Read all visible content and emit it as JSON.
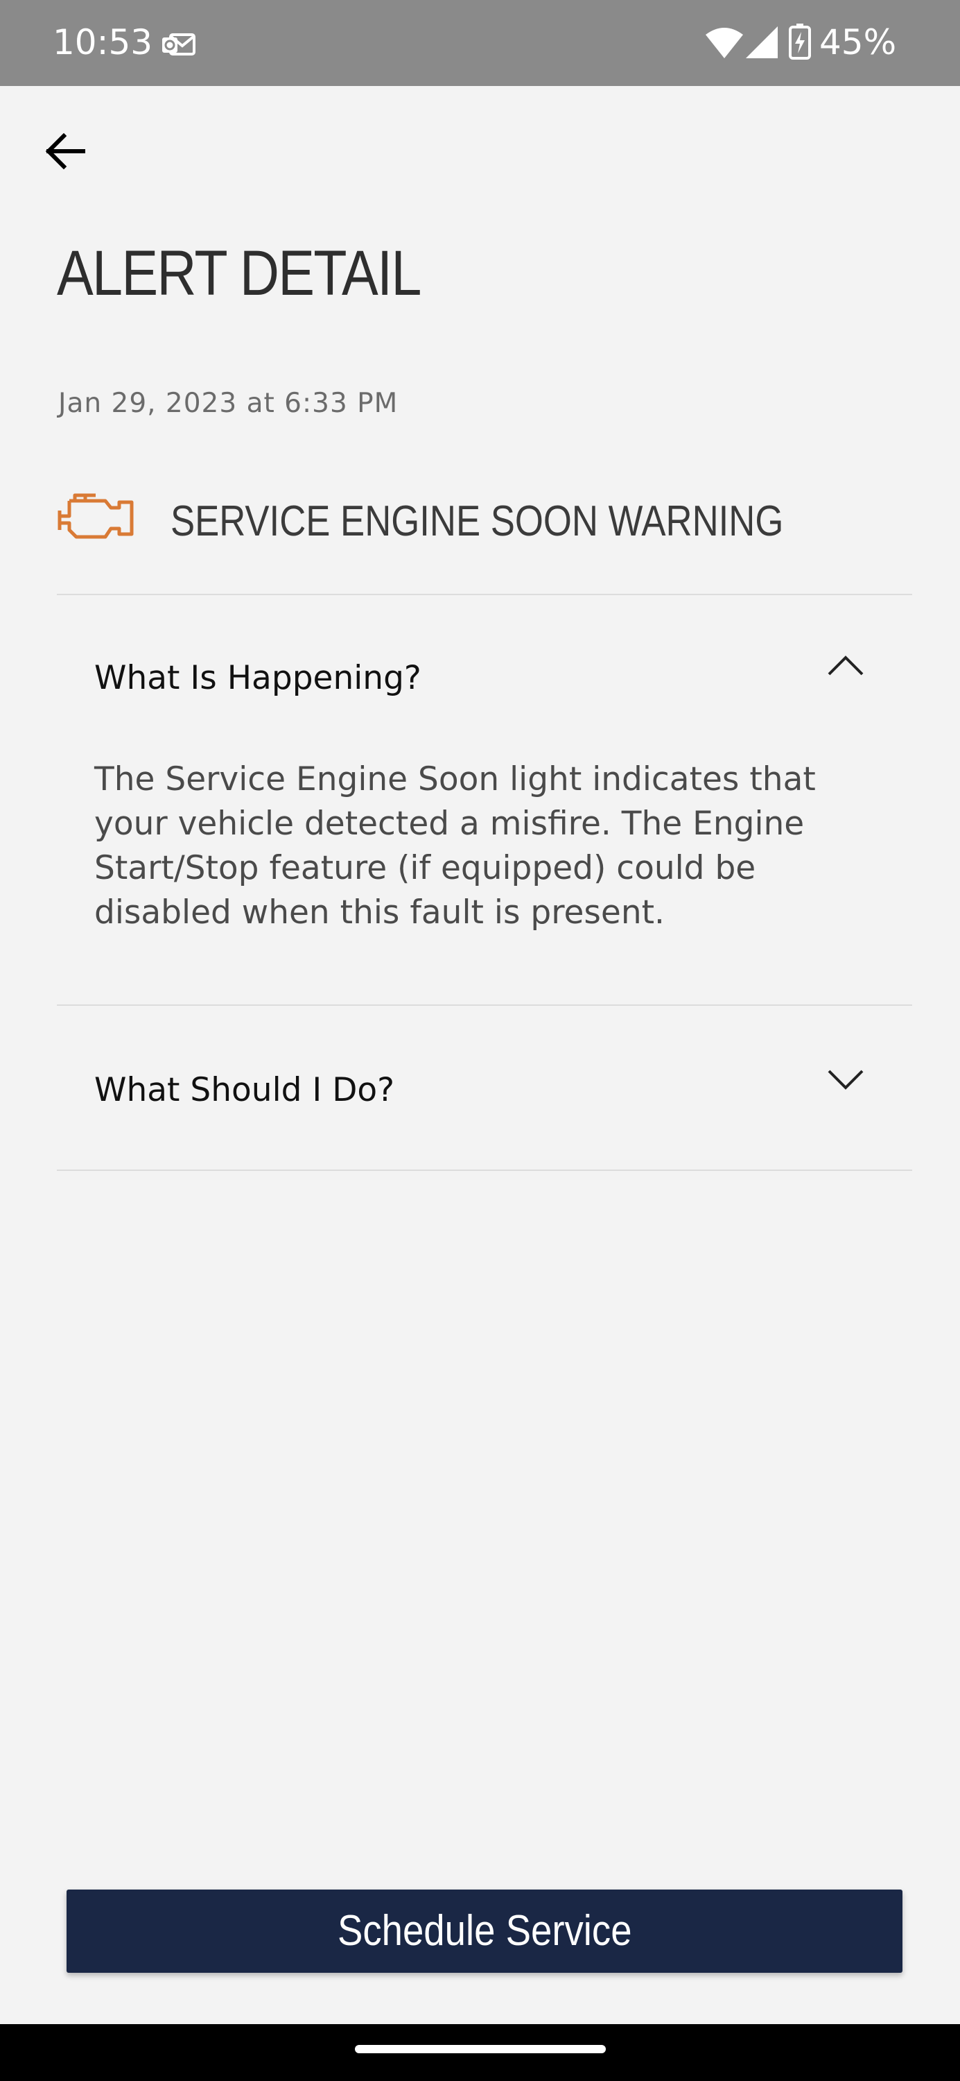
{
  "status_bar": {
    "time": "10:53",
    "battery_percent": "45%",
    "icons": [
      "outlook-notification-icon",
      "wifi-icon",
      "cell-signal-icon",
      "battery-charging-icon"
    ]
  },
  "header": {
    "back_icon": "arrow-left-icon",
    "title": "ALERT DETAIL"
  },
  "alert": {
    "timestamp": "Jan 29, 2023 at 6:33 PM",
    "icon": "engine-icon",
    "icon_color": "#d97a35",
    "title": "SERVICE ENGINE SOON WARNING"
  },
  "sections": [
    {
      "label": "What Is Happening?",
      "expanded": true,
      "chevron": "chevron-up-icon",
      "body": "The Service Engine Soon light indicates that your vehicle detected a misfire. The Engine Start/Stop feature (if equipped) could be disabled when this fault is present."
    },
    {
      "label": "What Should I Do?",
      "expanded": false,
      "chevron": "chevron-down-icon"
    }
  ],
  "actions": {
    "schedule_label": "Schedule Service",
    "button_color": "#1a2745"
  }
}
